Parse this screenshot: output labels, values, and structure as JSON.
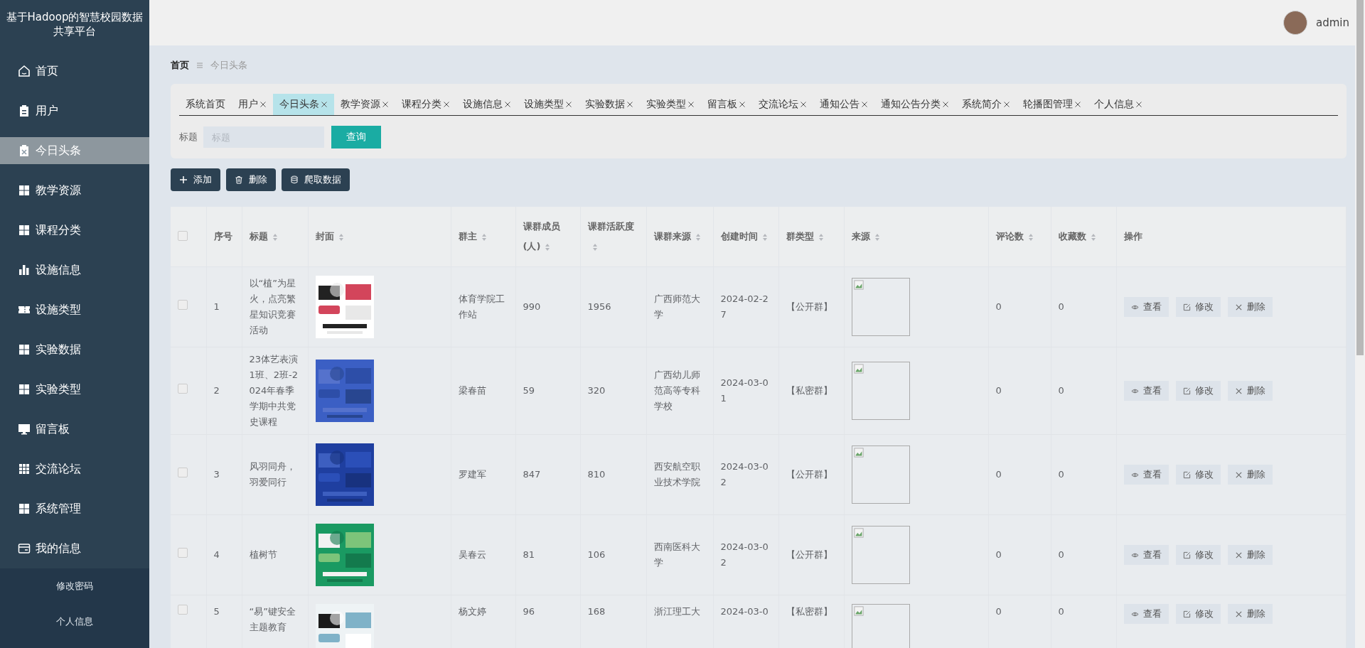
{
  "sidebar": {
    "title": "基于Hadoop的智慧校园数据共享平台",
    "menu": [
      {
        "label": "首页",
        "kind": "home",
        "selected": false
      },
      {
        "label": "用户",
        "kind": "clipboard",
        "selected": false
      },
      {
        "label": "今日头条",
        "kind": "clipboard-x",
        "selected": true
      },
      {
        "label": "教学资源",
        "kind": "grid",
        "selected": false
      },
      {
        "label": "课程分类",
        "kind": "grid",
        "selected": false
      },
      {
        "label": "设施信息",
        "kind": "bars",
        "selected": false
      },
      {
        "label": "设施类型",
        "kind": "ticket",
        "selected": false
      },
      {
        "label": "实验数据",
        "kind": "grid",
        "selected": false
      },
      {
        "label": "实验类型",
        "kind": "grid",
        "selected": false
      },
      {
        "label": "留言板",
        "kind": "monitor",
        "selected": false
      },
      {
        "label": "交流论坛",
        "kind": "grid9",
        "selected": false
      },
      {
        "label": "系统管理",
        "kind": "grid",
        "selected": false
      },
      {
        "label": "我的信息",
        "kind": "card",
        "selected": false
      }
    ],
    "submenu": [
      {
        "label": "修改密码"
      },
      {
        "label": "个人信息"
      }
    ]
  },
  "header": {
    "user": "admin"
  },
  "breadcrumb": [
    "首页",
    "今日头条"
  ],
  "tabs": [
    {
      "label": "系统首页",
      "closable": false,
      "selected": false
    },
    {
      "label": "用户",
      "closable": true,
      "selected": false
    },
    {
      "label": "今日头条",
      "closable": true,
      "selected": true
    },
    {
      "label": "教学资源",
      "closable": true,
      "selected": false
    },
    {
      "label": "课程分类",
      "closable": true,
      "selected": false
    },
    {
      "label": "设施信息",
      "closable": true,
      "selected": false
    },
    {
      "label": "设施类型",
      "closable": true,
      "selected": false
    },
    {
      "label": "实验数据",
      "closable": true,
      "selected": false
    },
    {
      "label": "实验类型",
      "closable": true,
      "selected": false
    },
    {
      "label": "留言板",
      "closable": true,
      "selected": false
    },
    {
      "label": "交流论坛",
      "closable": true,
      "selected": false
    },
    {
      "label": "通知公告",
      "closable": true,
      "selected": false
    },
    {
      "label": "通知公告分类",
      "closable": true,
      "selected": false
    },
    {
      "label": "系统简介",
      "closable": true,
      "selected": false
    },
    {
      "label": "轮播图管理",
      "closable": true,
      "selected": false
    },
    {
      "label": "个人信息",
      "closable": true,
      "selected": false
    }
  ],
  "search": {
    "label": "标题",
    "placeholder": "标题",
    "button": "查询"
  },
  "toolbar": [
    {
      "label": "添加",
      "kind": "plus"
    },
    {
      "label": "删除",
      "kind": "trash"
    },
    {
      "label": "爬取数据",
      "kind": "database"
    }
  ],
  "table": {
    "header_checked": false,
    "columns": [
      {
        "label": "序号",
        "sortable": false
      },
      {
        "label": "标题",
        "sortable": true
      },
      {
        "label": "封面",
        "sortable": true
      },
      {
        "label": "群主",
        "sortable": true
      },
      {
        "label": "课群成员(人)",
        "sortable": true
      },
      {
        "label": "课群活跃度",
        "sortable": true
      },
      {
        "label": "课群来源",
        "sortable": true
      },
      {
        "label": "创建时间",
        "sortable": true
      },
      {
        "label": "群类型",
        "sortable": true
      },
      {
        "label": "来源",
        "sortable": true
      },
      {
        "label": "评论数",
        "sortable": true
      },
      {
        "label": "收藏数",
        "sortable": true
      },
      {
        "label": "操作",
        "sortable": false
      }
    ],
    "rows": [
      {
        "checked": false,
        "no": "1",
        "title": "以“植”为星火，点亮繁星知识竞赛活动",
        "owner": "体育学院工作站",
        "members": "990",
        "activity": "1956",
        "school": "广西师范大学",
        "created": "2024-02-27",
        "group_type": "【公开群】",
        "comments": "0",
        "favorites": "0",
        "actions": [
          "查看",
          "修改",
          "删除"
        ]
      },
      {
        "checked": false,
        "no": "2",
        "title": "23体艺表演1班、2班-2024年春季学期中共党史课程",
        "owner": "梁春苗",
        "members": "59",
        "activity": "320",
        "school": "广西幼儿师范高等专科学校",
        "created": "2024-03-01",
        "group_type": "【私密群】",
        "comments": "0",
        "favorites": "0",
        "actions": [
          "查看",
          "修改",
          "删除"
        ]
      },
      {
        "checked": false,
        "no": "3",
        "title": "风羽同舟，羽爱同行",
        "owner": "罗建军",
        "members": "847",
        "activity": "810",
        "school": "西安航空职业技术学院",
        "created": "2024-03-02",
        "group_type": "【公开群】",
        "comments": "0",
        "favorites": "0",
        "actions": [
          "查看",
          "修改",
          "删除"
        ]
      },
      {
        "checked": false,
        "no": "4",
        "title": "植树节",
        "owner": "吴春云",
        "members": "81",
        "activity": "106",
        "school": "西南医科大学",
        "created": "2024-03-02",
        "group_type": "【公开群】",
        "comments": "0",
        "favorites": "0",
        "actions": [
          "查看",
          "修改",
          "删除"
        ]
      },
      {
        "checked": false,
        "no": "5",
        "title": "“易”键安全主题教育",
        "owner": "杨文婷",
        "members": "96",
        "activity": "168",
        "school": "浙江理工大",
        "created": "2024-03-0",
        "group_type": "【私密群】",
        "comments": "0",
        "favorites": "0",
        "actions": [
          "查看",
          "修改",
          "删除"
        ]
      }
    ]
  }
}
